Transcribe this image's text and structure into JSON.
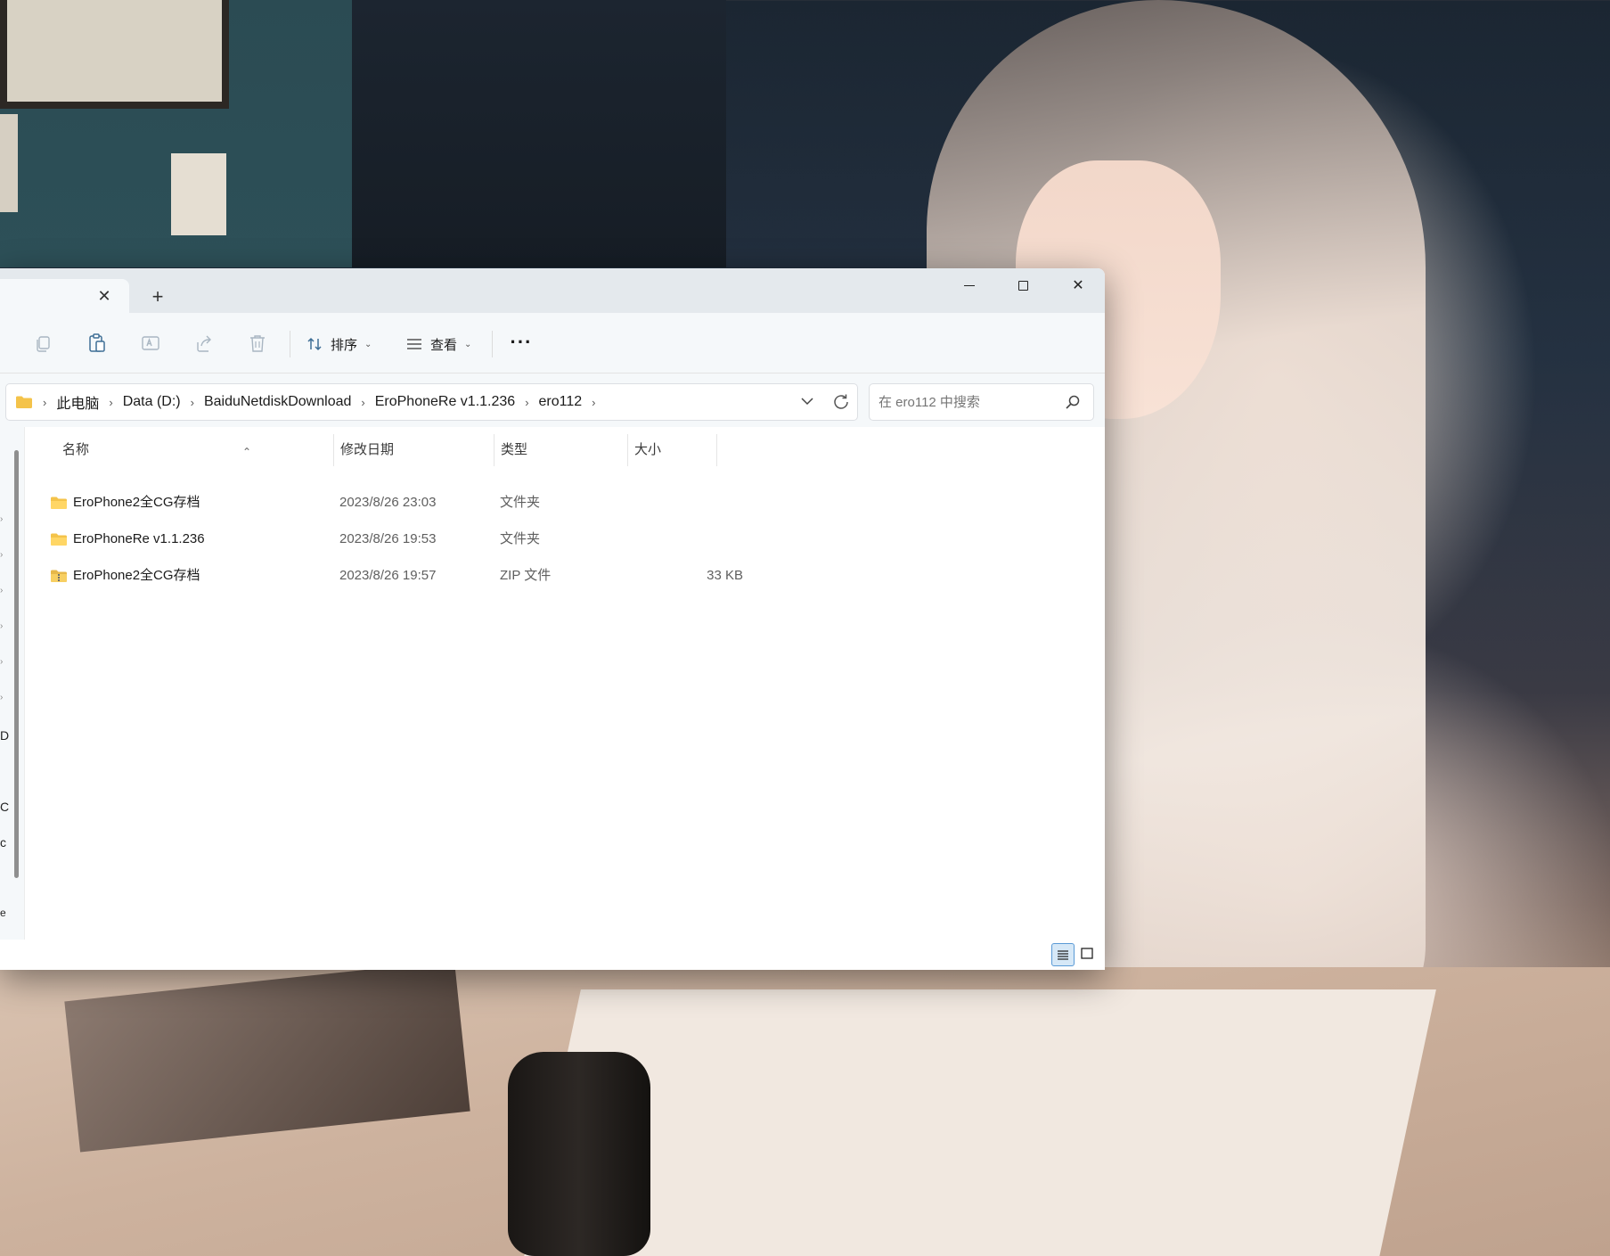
{
  "window": {
    "tab_close_glyph": "✕",
    "new_tab_glyph": "+",
    "close_glyph": "✕"
  },
  "toolbar": {
    "sort_label": "排序",
    "view_label": "查看",
    "more_label": "···",
    "icons": [
      "copy-icon",
      "paste-icon",
      "rename-icon",
      "share-icon",
      "delete-icon"
    ]
  },
  "address": {
    "crumbs": [
      "此电脑",
      "Data (D:)",
      "BaiduNetdiskDownload",
      "EroPhoneRe v1.1.236",
      "ero112"
    ],
    "separator": "›"
  },
  "search": {
    "placeholder": "在 ero112 中搜索"
  },
  "columns": {
    "name": "名称",
    "date": "修改日期",
    "type": "类型",
    "size": "大小"
  },
  "files": [
    {
      "name": "EroPhone2全CG存档",
      "date": "2023/8/26 23:03",
      "type": "文件夹",
      "size": "",
      "icon": "folder-icon"
    },
    {
      "name": "EroPhoneRe v1.1.236",
      "date": "2023/8/26 19:53",
      "type": "文件夹",
      "size": "",
      "icon": "folder-icon"
    },
    {
      "name": "EroPhone2全CG存档",
      "date": "2023/8/26 19:57",
      "type": "ZIP 文件",
      "size": "33 KB",
      "icon": "zip-folder-icon"
    }
  ],
  "navpane": {
    "partial_labels": [
      "D",
      "C",
      "c",
      "e"
    ]
  },
  "colors": {
    "accent": "#005fb8",
    "folder": "#f4c34a",
    "chrome": "#f5f8fa",
    "tabbar": "#e4e9ed"
  }
}
